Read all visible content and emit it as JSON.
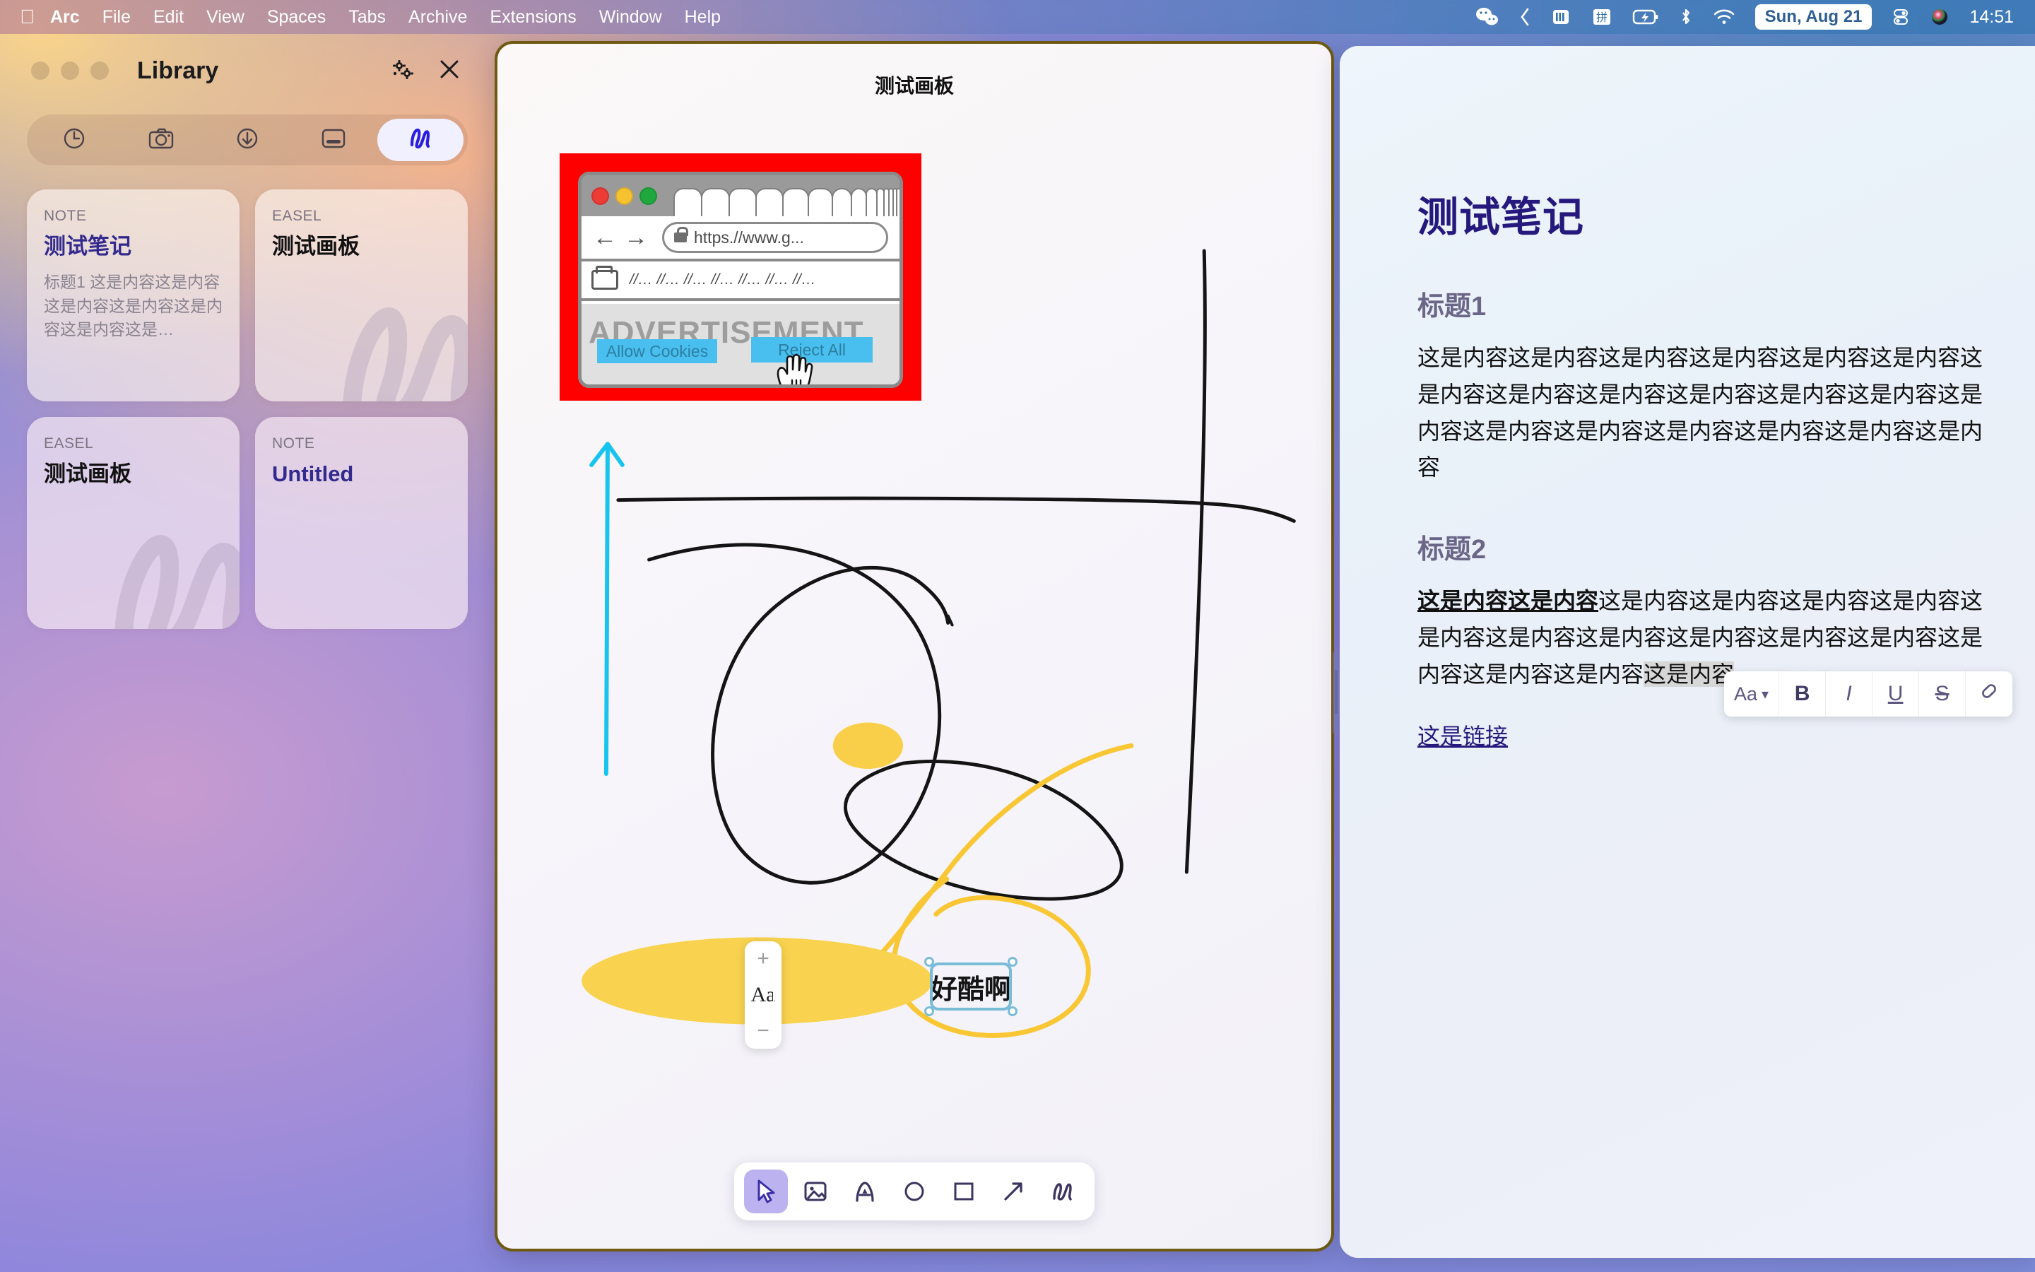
{
  "menubar": {
    "apple_icon": "apple-logo",
    "items": [
      "Arc",
      "File",
      "Edit",
      "View",
      "Spaces",
      "Tabs",
      "Archive",
      "Extensions",
      "Window",
      "Help"
    ],
    "status_icons": [
      "wechat-icon",
      "chevron-left-icon",
      "battery-menu-icon",
      "input-source-pinyin-icon",
      "battery-charging-icon",
      "bluetooth-icon",
      "wifi-icon"
    ],
    "date": "Sun, Aug 21",
    "control_center_icon": "control-center-icon",
    "siri_icon": "siri-icon",
    "time": "14:51"
  },
  "library": {
    "title": "Library",
    "settings_icon": "gears-icon",
    "close_icon": "close-icon",
    "tabs": [
      {
        "icon": "clock-icon",
        "name": "recents",
        "active": false
      },
      {
        "icon": "camera-icon",
        "name": "captures",
        "active": false
      },
      {
        "icon": "download-icon",
        "name": "downloads",
        "active": false
      },
      {
        "icon": "window-icon",
        "name": "archived-tabs",
        "active": false
      },
      {
        "icon": "pen-squiggle-icon",
        "name": "easels-notes",
        "active": true
      }
    ],
    "cards": [
      {
        "kind": "NOTE",
        "title": "测试笔记",
        "title_color": "#332a8e",
        "body": "标题1\n这是内容这是内容这是内容这是内容这是内容这是内容这是…"
      },
      {
        "kind": "EASEL",
        "title": "测试画板",
        "title_color": "#111111",
        "body": ""
      },
      {
        "kind": "EASEL",
        "title": "测试画板",
        "title_color": "#111111",
        "body": ""
      },
      {
        "kind": "NOTE",
        "title": "Untitled",
        "title_color": "#332a8e",
        "body": ""
      }
    ]
  },
  "easel": {
    "title": "测试画板",
    "browser_illustration": {
      "url": "https.//www.g...",
      "bookmarks": "//…  //…  //…  //…  //…  //…  //…",
      "ad_label": "ADVERTISEMENT",
      "allow_button": "Allow Cookies",
      "reject_button": "Reject All",
      "background_color": "#fe0000"
    },
    "font_popover": {
      "increase": "+",
      "label": "Aa",
      "decrease": "−"
    },
    "text_object": "好酷啊",
    "toolbar": [
      {
        "icon": "cursor-icon",
        "name": "select-tool",
        "active": true
      },
      {
        "icon": "image-icon",
        "name": "image-tool",
        "active": false
      },
      {
        "icon": "text-a-icon",
        "name": "text-tool",
        "active": false
      },
      {
        "icon": "circle-icon",
        "name": "ellipse-tool",
        "active": false
      },
      {
        "icon": "square-icon",
        "name": "rectangle-tool",
        "active": false
      },
      {
        "icon": "arrow-icon",
        "name": "arrow-tool",
        "active": false
      },
      {
        "icon": "pen-squiggle-icon",
        "name": "pen-tool",
        "active": false
      }
    ],
    "ink_colors": {
      "black": "#111111",
      "cyan": "#17c4f0",
      "yellow": "#f9cf4a"
    }
  },
  "note": {
    "title": "测试笔记",
    "heading1": "标题1",
    "para1": "这是内容这是内容这是内容这是内容这是内容这是内容这是内容这是内容这是内容这是内容这是内容这是内容这是内容这是内容这是内容这是内容这是内容这是内容这是内容",
    "heading2": "标题2",
    "para2_bold_underline": "这是内容这是内容",
    "para2_rest": "这是内容这是内容这是内容这是内容这是内容这是内容这是内容这是内容这是内容这是内容这是内容这是内容这是内容",
    "para2_highlighted": "这是内容",
    "link": "这是链接",
    "format_toolbar": {
      "style_label": "Aa",
      "style_caret": "▾",
      "bold": "B",
      "italic": "I",
      "underline": "U",
      "strike": "S",
      "link_icon": "link-icon"
    }
  }
}
